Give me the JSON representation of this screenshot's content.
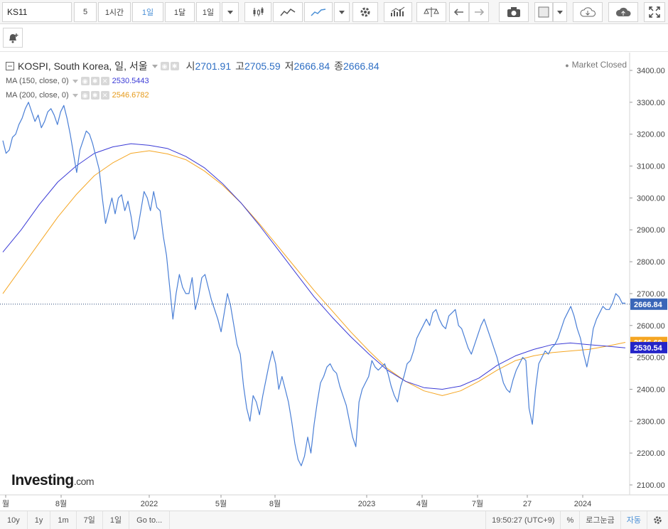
{
  "toolbar": {
    "symbol": "KS11",
    "intervals": [
      "5",
      "1시간",
      "1일",
      "1달",
      "1일"
    ],
    "active_interval": "1일",
    "icons": [
      "candlestick-icon",
      "line-chart-icon",
      "area-chart-icon",
      "settings-gear-icon",
      "indicators-icon",
      "compare-scale-icon",
      "undo-icon",
      "redo-icon",
      "camera-icon",
      "color-square-icon",
      "cloud-download-icon",
      "cloud-upload-icon",
      "fullscreen-icon"
    ]
  },
  "legend": {
    "title": "KOSPI, South Korea, 일, 서울",
    "open_label": "시",
    "open": "2701.91",
    "high_label": "고",
    "high": "2705.59",
    "low_label": "저",
    "low": "2666.84",
    "close_label": "종",
    "close": "2666.84",
    "ma150_label": "MA (150, close, 0)",
    "ma150_value": "2530.5443",
    "ma200_label": "MA (200, close, 0)",
    "ma200_value": "2546.6782",
    "market_status": "Market Closed"
  },
  "watermark": {
    "brand": "Investing",
    "domain": ".com"
  },
  "chart_data": {
    "type": "line",
    "y_ticks": [
      3400,
      3300,
      3200,
      3100,
      3000,
      2900,
      2800,
      2700,
      2600,
      2500,
      2400,
      2300,
      2200,
      2100
    ],
    "x_ticks": [
      "월",
      "8월",
      "2022",
      "5월",
      "8월",
      "2023",
      "4월",
      "7월",
      "27",
      "2024"
    ],
    "ylim": [
      2060,
      3460
    ],
    "price_labels": {
      "close": "2666.84",
      "ma200": "2546.68",
      "ma150": "2530.54"
    },
    "colors": {
      "price": "#4a7fd6",
      "ma150": "#3b3bd6",
      "ma200": "#f5a623",
      "close_line": "#2c4a7a"
    },
    "series": [
      {
        "name": "KOSPI",
        "values": [
          3180,
          3140,
          3150,
          3190,
          3200,
          3230,
          3250,
          3280,
          3300,
          3270,
          3240,
          3260,
          3220,
          3240,
          3270,
          3280,
          3260,
          3230,
          3270,
          3290,
          3250,
          3200,
          3140,
          3080,
          3150,
          3180,
          3210,
          3200,
          3170,
          3130,
          3090,
          3000,
          2920,
          2960,
          3000,
          2950,
          3000,
          3010,
          2960,
          2990,
          2940,
          2870,
          2900,
          2960,
          3020,
          3000,
          2960,
          3020,
          2970,
          2960,
          2880,
          2820,
          2720,
          2620,
          2700,
          2760,
          2720,
          2700,
          2700,
          2750,
          2650,
          2690,
          2750,
          2760,
          2720,
          2680,
          2650,
          2620,
          2580,
          2640,
          2700,
          2660,
          2600,
          2540,
          2510,
          2410,
          2340,
          2300,
          2380,
          2360,
          2320,
          2380,
          2430,
          2480,
          2520,
          2480,
          2400,
          2440,
          2400,
          2360,
          2300,
          2230,
          2180,
          2160,
          2190,
          2250,
          2200,
          2290,
          2360,
          2420,
          2440,
          2470,
          2480,
          2460,
          2450,
          2410,
          2380,
          2350,
          2300,
          2250,
          2220,
          2360,
          2400,
          2420,
          2440,
          2490,
          2470,
          2460,
          2470,
          2480,
          2450,
          2410,
          2380,
          2360,
          2410,
          2440,
          2480,
          2490,
          2520,
          2560,
          2580,
          2600,
          2620,
          2600,
          2640,
          2650,
          2620,
          2600,
          2590,
          2630,
          2640,
          2650,
          2600,
          2590,
          2560,
          2530,
          2510,
          2540,
          2570,
          2600,
          2620,
          2590,
          2560,
          2530,
          2500,
          2460,
          2420,
          2400,
          2390,
          2430,
          2460,
          2480,
          2500,
          2490,
          2340,
          2290,
          2400,
          2480,
          2500,
          2520,
          2510,
          2530,
          2540,
          2560,
          2590,
          2620,
          2640,
          2660,
          2630,
          2590,
          2560,
          2510,
          2470,
          2520,
          2590,
          2620,
          2640,
          2660,
          2650,
          2650,
          2670,
          2700,
          2690,
          2670,
          2670
        ]
      },
      {
        "name": "MA (150, close, 0)",
        "values": [
          2830,
          2900,
          2980,
          3050,
          3100,
          3140,
          3160,
          3170,
          3165,
          3155,
          3130,
          3095,
          3045,
          2985,
          2915,
          2840,
          2765,
          2690,
          2625,
          2565,
          2510,
          2460,
          2425,
          2405,
          2400,
          2410,
          2435,
          2475,
          2505,
          2525,
          2540,
          2545,
          2540,
          2535,
          2530
        ]
      },
      {
        "name": "MA (200, close, 0)",
        "values": [
          2700,
          2780,
          2860,
          2940,
          3010,
          3070,
          3110,
          3140,
          3148,
          3138,
          3120,
          3085,
          3040,
          2985,
          2920,
          2850,
          2780,
          2710,
          2645,
          2580,
          2520,
          2465,
          2425,
          2395,
          2380,
          2395,
          2425,
          2460,
          2490,
          2505,
          2515,
          2520,
          2525,
          2535,
          2547
        ]
      }
    ]
  },
  "bottom": {
    "ranges": [
      "10y",
      "1y",
      "1m",
      "7일",
      "1일"
    ],
    "goto": "Go to...",
    "time": "19:50:27 (UTC+9)",
    "percent": "%",
    "log": "로그눈금",
    "auto": "자동"
  }
}
